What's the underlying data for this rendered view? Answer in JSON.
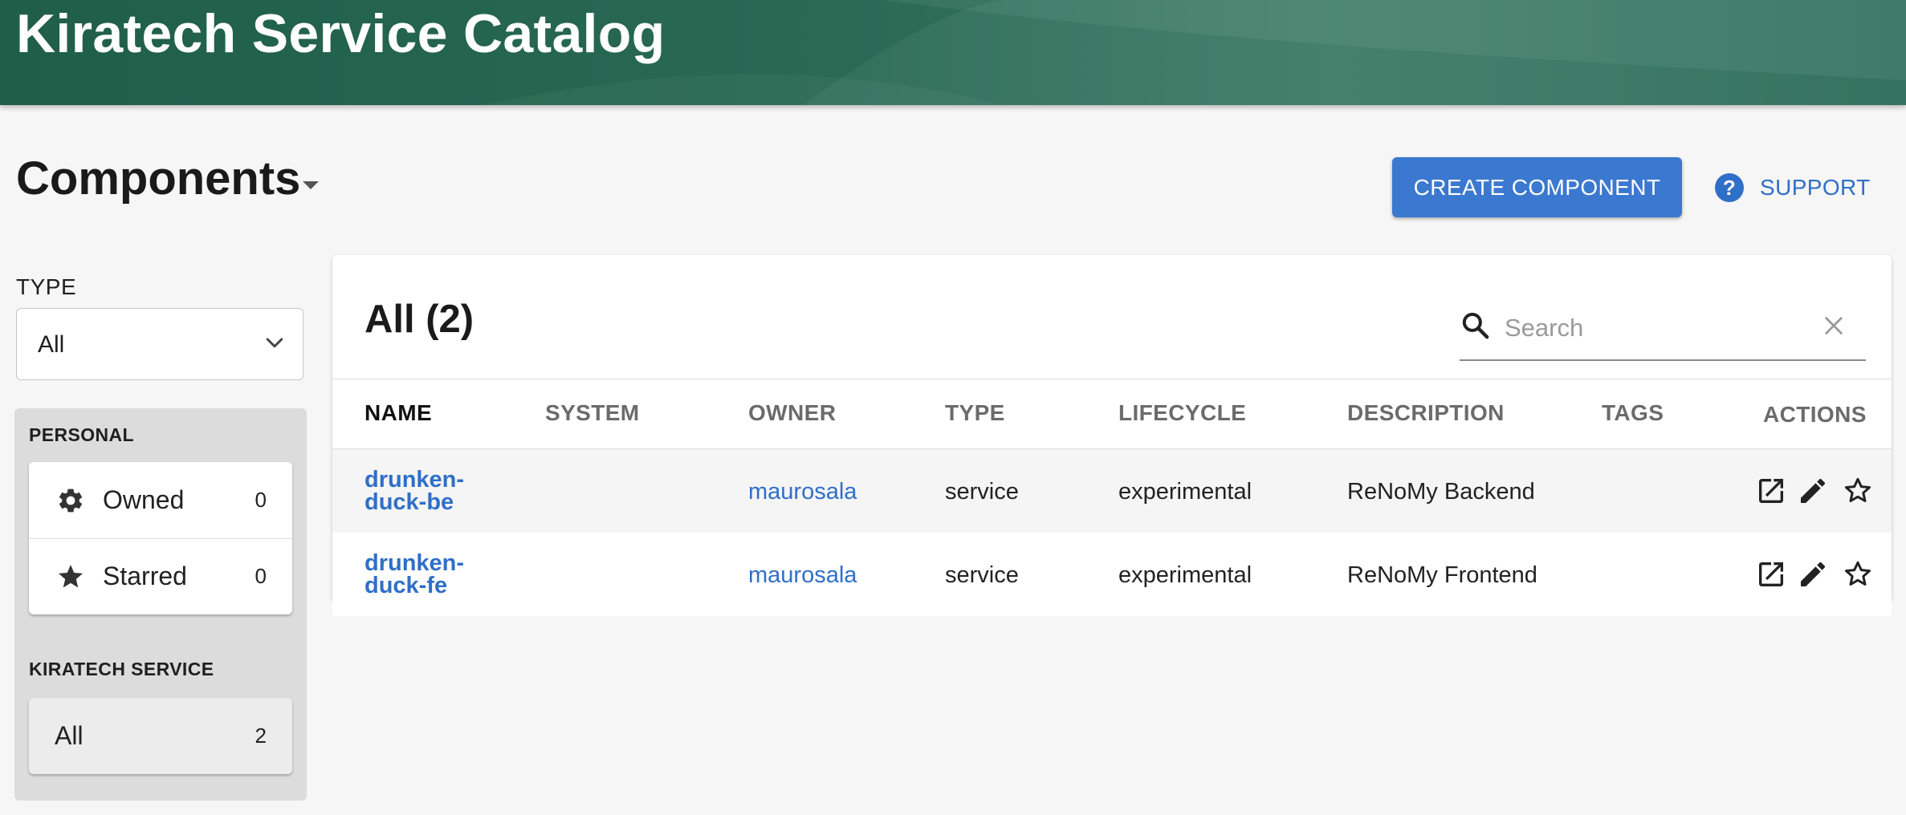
{
  "header": {
    "title": "Kiratech Service Catalog"
  },
  "page": {
    "title": "Components",
    "create_button": "CREATE COMPONENT",
    "support_label": "SUPPORT",
    "help_glyph": "?"
  },
  "sidebar": {
    "type_label": "TYPE",
    "type_value": "All",
    "personal_label": "PERSONAL",
    "personal_items": [
      {
        "label": "Owned",
        "count": "0",
        "icon": "gear-icon"
      },
      {
        "label": "Starred",
        "count": "0",
        "icon": "star-icon"
      }
    ],
    "service_label": "KIRATECH SERVICE",
    "service_items": [
      {
        "label": "All",
        "count": "2"
      }
    ]
  },
  "table": {
    "title": "All (2)",
    "search_placeholder": "Search",
    "columns": [
      "NAME",
      "SYSTEM",
      "OWNER",
      "TYPE",
      "LIFECYCLE",
      "DESCRIPTION",
      "TAGS",
      "ACTIONS"
    ],
    "rows": [
      {
        "name_line1": "drunken-",
        "name_line2": "duck-be",
        "system": "",
        "owner": "maurosala",
        "type": "service",
        "lifecycle": "experimental",
        "description": "ReNoMy Backend",
        "tags": ""
      },
      {
        "name_line1": "drunken-",
        "name_line2": "duck-fe",
        "system": "",
        "owner": "maurosala",
        "type": "service",
        "lifecycle": "experimental",
        "description": "ReNoMy Frontend",
        "tags": ""
      }
    ],
    "action_icons": [
      "open-external-icon",
      "edit-icon",
      "star-outline-icon"
    ]
  },
  "colors": {
    "header": "#2a6a55",
    "accent": "#3b78d0",
    "link": "#2f6fc8"
  }
}
